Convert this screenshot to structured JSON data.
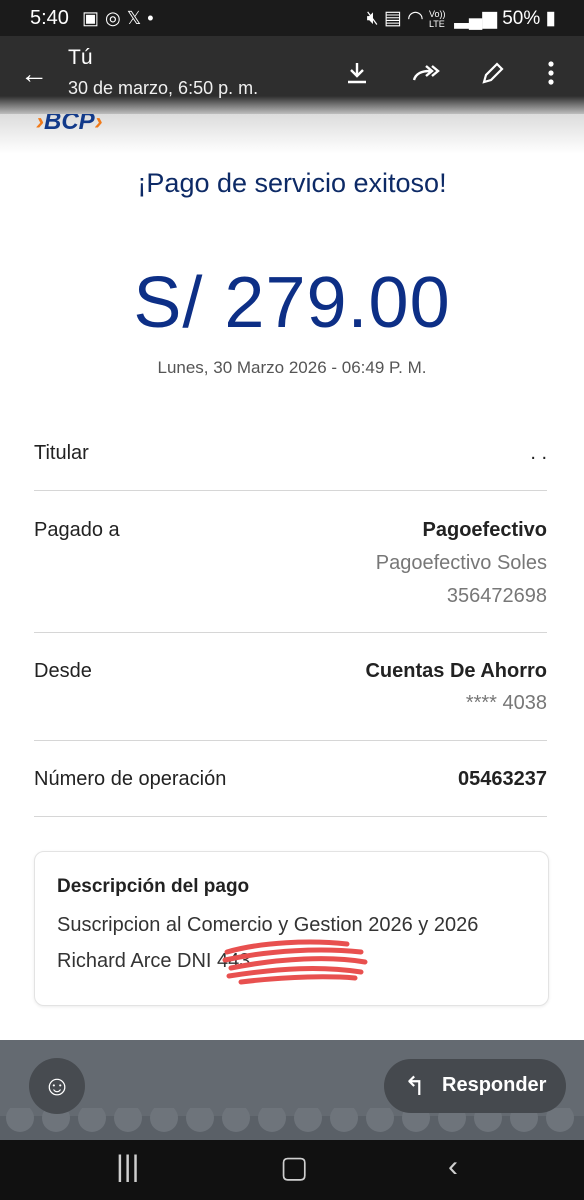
{
  "status_bar": {
    "time": "5:40",
    "notification_icons": [
      "image-icon",
      "instagram-icon",
      "x-icon",
      "dot-icon"
    ],
    "right_icons": [
      "mute-icon",
      "battery-saver-icon",
      "wifi-icon",
      "volte-icon",
      "signal-icon"
    ],
    "volte_text": "Vo)) LTE",
    "battery": "50%"
  },
  "app_bar": {
    "sender": "Tú",
    "date": "30 de marzo, 6:50 p. m.",
    "actions": [
      "download-icon",
      "forward-icon",
      "edit-icon",
      "more-icon"
    ]
  },
  "receipt": {
    "bank_logo": "BCP",
    "title": "¡Pago de servicio exitoso!",
    "amount": "S/ 279.00",
    "datetime": "Lunes, 30 Marzo 2026 - 06:49 P. M.",
    "rows": {
      "titular": {
        "label": "Titular",
        "value": ". ."
      },
      "pagado": {
        "label": "Pagado a",
        "value": "Pagoefectivo",
        "sub1": "Pagoefectivo Soles",
        "sub2": "356472698"
      },
      "desde": {
        "label": "Desde",
        "value": "Cuentas De Ahorro",
        "sub1": "**** 4038"
      },
      "operacion": {
        "label": "Número de operación",
        "value": "05463237"
      }
    },
    "description": {
      "title": "Descripción del pago",
      "line1": "Suscripcion al Comercio y Gestion 2026 y 2026",
      "line2": "Richard Arce DNI 443"
    }
  },
  "bottom": {
    "reply_label": "Responder"
  },
  "colors": {
    "brand_blue": "#0d2f86",
    "brand_orange": "#f07a1a",
    "redaction": "#e8504f"
  }
}
